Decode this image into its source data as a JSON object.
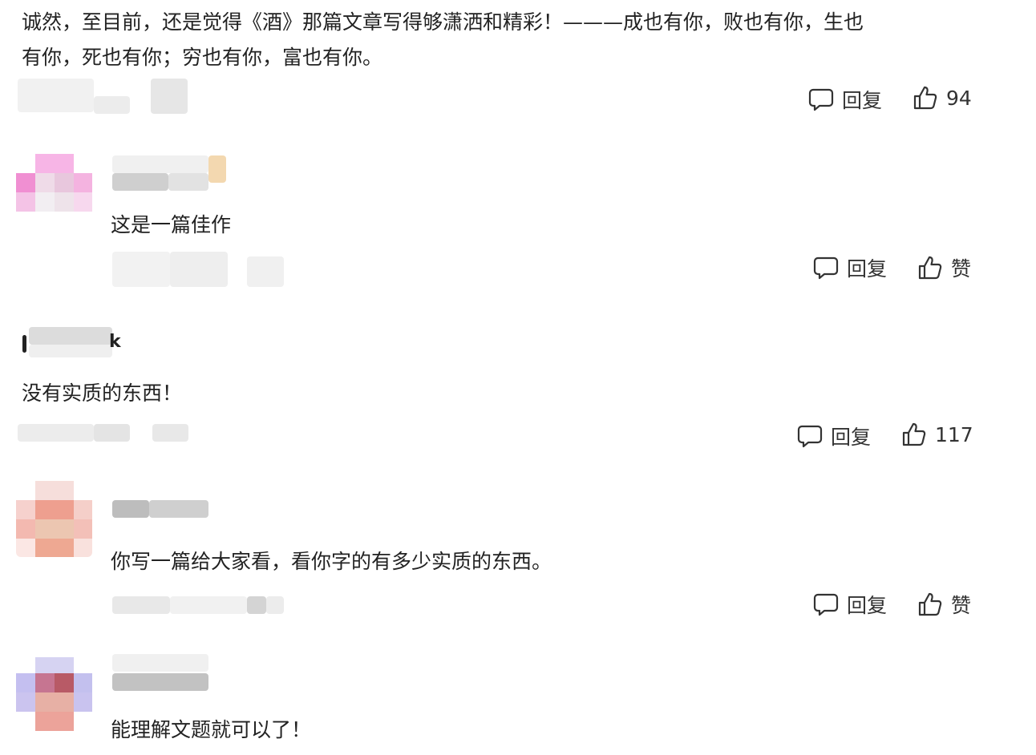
{
  "comments": [
    {
      "text_line1": "诚然，至目前，还是觉得《酒》那篇文章写得够潇洒和精彩！———成也有你，败也有你，生也",
      "text_line2": "有你，死也有你；穷也有你，富也有你。",
      "reply_label": "回复",
      "like_label": "94"
    },
    {
      "text": "这是一篇佳作",
      "reply_label": "回复",
      "like_label": "赞"
    },
    {
      "username_suffix": "k",
      "text": "没有实质的东西！",
      "reply_label": "回复",
      "like_label": "117"
    },
    {
      "text": "你写一篇给大家看，看你字的有多少实质的东西。",
      "reply_label": "回复",
      "like_label": "赞"
    },
    {
      "text": "能理解文题就可以了！"
    }
  ],
  "icons": {
    "reply": "comment-bubble-icon",
    "like": "thumbs-up-icon"
  },
  "colors": {
    "text": "#222222",
    "action": "#333333",
    "blur_gray": "#d9d9d9"
  }
}
